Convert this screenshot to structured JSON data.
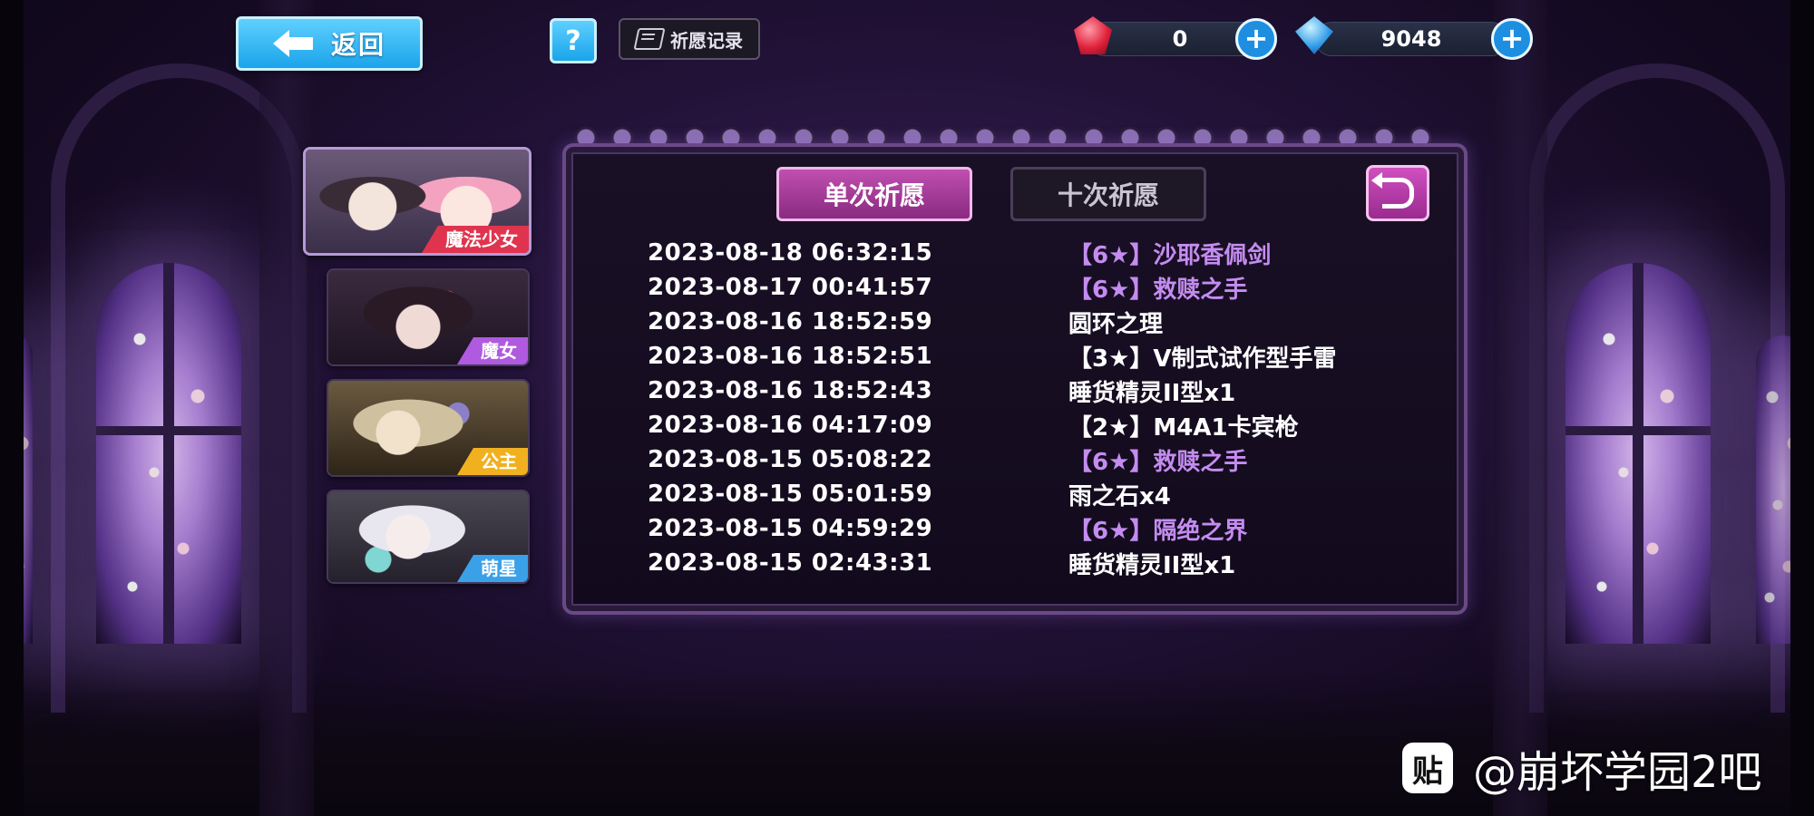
{
  "topbar": {
    "back_label": "返回",
    "help_label": "?",
    "record_label": "祈愿记录",
    "ruby": {
      "icon": "ruby-icon",
      "value": "0",
      "plus": "+"
    },
    "crystal": {
      "icon": "crystal-icon",
      "value": "9048",
      "plus": "+"
    }
  },
  "sidebar": {
    "tabs": [
      {
        "label": "魔法少女",
        "color": "#e0344e",
        "active": true
      },
      {
        "label": "魔女",
        "color": "#b05ae0",
        "active": false
      },
      {
        "label": "公主",
        "color": "#f0b020",
        "active": false
      },
      {
        "label": "萌星",
        "color": "#3aa0e8",
        "active": false
      }
    ]
  },
  "panel": {
    "tab_single": "单次祈愿",
    "tab_ten": "十次祈愿",
    "undo_icon": "undo-icon",
    "records": [
      {
        "date": "2023-08-18 06:32:15",
        "item": "【6★】沙耶香佩剑",
        "rare": true
      },
      {
        "date": "2023-08-17 00:41:57",
        "item": "【6★】救赎之手",
        "rare": true
      },
      {
        "date": "2023-08-16 18:52:59",
        "item": "圆环之理",
        "rare": false
      },
      {
        "date": "2023-08-16 18:52:51",
        "item": "【3★】V制式试作型手雷",
        "rare": false
      },
      {
        "date": "2023-08-16 18:52:43",
        "item": "睡货精灵II型x1",
        "rare": false
      },
      {
        "date": "2023-08-16 04:17:09",
        "item": "【2★】M4A1卡宾枪",
        "rare": false
      },
      {
        "date": "2023-08-15 05:08:22",
        "item": "【6★】救赎之手",
        "rare": true
      },
      {
        "date": "2023-08-15 05:01:59",
        "item": "雨之石x4",
        "rare": false
      },
      {
        "date": "2023-08-15 04:59:29",
        "item": "【6★】隔绝之界",
        "rare": true
      },
      {
        "date": "2023-08-15 02:43:31",
        "item": "睡货精灵II型x1",
        "rare": false
      }
    ]
  },
  "watermark": {
    "logo": "贴",
    "text": "@崩坏学园2吧"
  },
  "colors": {
    "rare": "#c48cf0",
    "accent": "#c04fb0",
    "button_blue": "#1aa4ea"
  }
}
